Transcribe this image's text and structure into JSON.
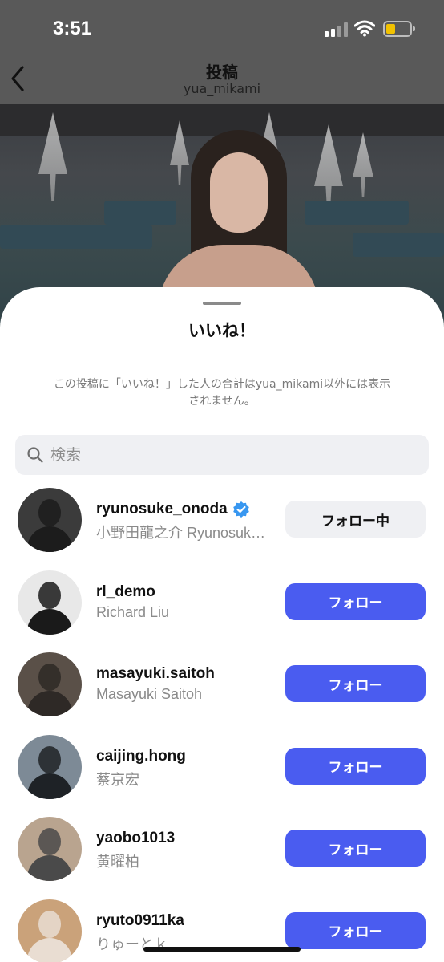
{
  "status_bar": {
    "time": "3:51"
  },
  "header": {
    "title": "投稿",
    "subtitle": "yua_mikami"
  },
  "sheet": {
    "title": "いいね！",
    "notice": "この投稿に「いいね！」した人の合計はyua_mikami以外には表示されません。",
    "search": {
      "placeholder": "検索",
      "value": ""
    }
  },
  "users": [
    {
      "username": "ryunosuke_onoda",
      "full_name": "小野田龍之介 Ryunosuke Onoda",
      "verified": true,
      "button": "フォロー中",
      "button_state": "following",
      "avatar_colors": [
        "#3b3b3b",
        "#1c1c1c"
      ]
    },
    {
      "username": "rl_demo",
      "full_name": "Richard Liu",
      "verified": false,
      "button": "フォロー",
      "button_state": "follow",
      "avatar_colors": [
        "#e8e8e8",
        "#1a1a1a"
      ]
    },
    {
      "username": "masayuki.saitoh",
      "full_name": "Masayuki  Saitoh",
      "verified": false,
      "button": "フォロー",
      "button_state": "follow",
      "avatar_colors": [
        "#5a5048",
        "#2e2926"
      ]
    },
    {
      "username": "caijing.hong",
      "full_name": "蔡京宏",
      "verified": false,
      "button": "フォロー",
      "button_state": "follow",
      "avatar_colors": [
        "#7d8a96",
        "#1e2226"
      ]
    },
    {
      "username": "yaobo1013",
      "full_name": "黄曜柏",
      "verified": false,
      "button": "フォロー",
      "button_state": "follow",
      "avatar_colors": [
        "#b9a48f",
        "#4a4a4a"
      ]
    },
    {
      "username": "ryuto0911ka",
      "full_name": "りゅーとｋ",
      "verified": false,
      "button": "フォロー",
      "button_state": "follow",
      "avatar_colors": [
        "#caa27a",
        "#e9ddd2"
      ]
    }
  ],
  "colors": {
    "follow_button": "#4a5cf0",
    "following_button": "#eff0f3",
    "verified_badge": "#3897f0",
    "battery": "#f2c200"
  }
}
